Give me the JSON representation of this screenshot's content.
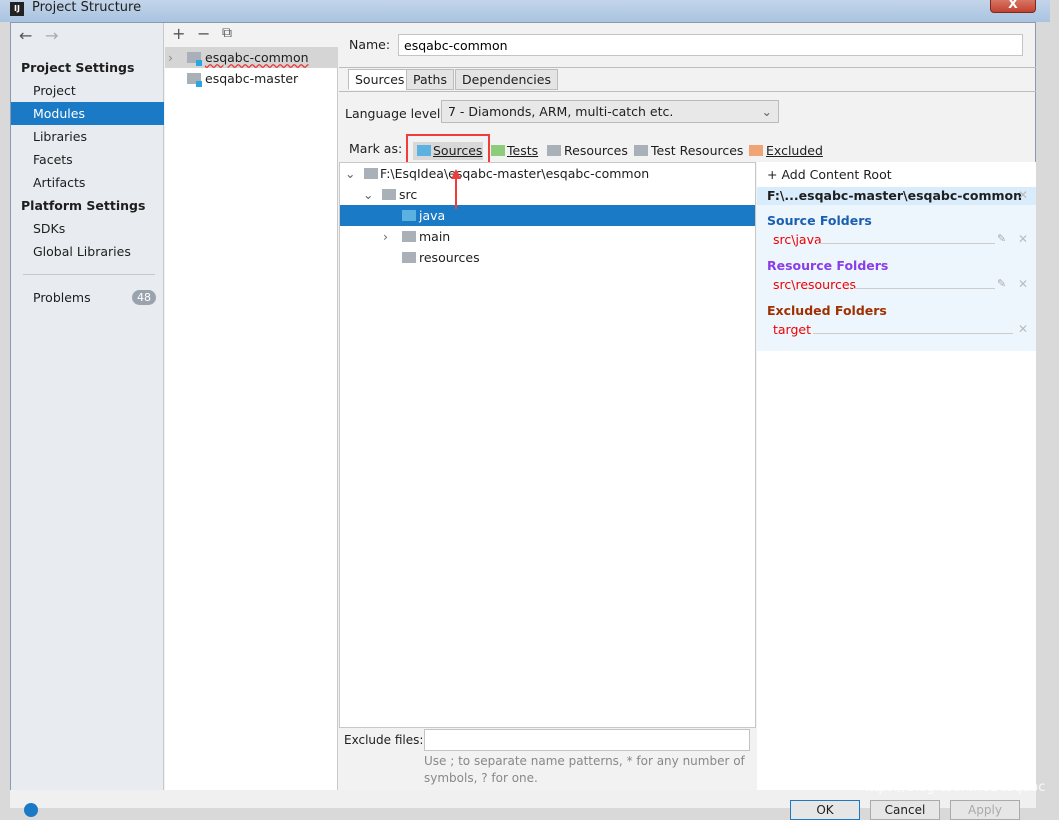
{
  "window": {
    "title": "Project Structure",
    "app_icon": "IJ",
    "close": "X"
  },
  "sidebar": {
    "back": "←",
    "forward": "→",
    "project_settings": "Project Settings",
    "items": [
      {
        "label": "Project"
      },
      {
        "label": "Modules"
      },
      {
        "label": "Libraries"
      },
      {
        "label": "Facets"
      },
      {
        "label": "Artifacts"
      }
    ],
    "platform_settings": "Platform Settings",
    "platform_items": [
      {
        "label": "SDKs"
      },
      {
        "label": "Global Libraries"
      }
    ],
    "problems": {
      "label": "Problems",
      "count": "48"
    }
  },
  "modules": {
    "toolbar": {
      "add": "+",
      "remove": "−",
      "copy": "⧉"
    },
    "items": [
      {
        "label": "esqabc-common",
        "selected": true
      },
      {
        "label": "esqabc-master"
      }
    ]
  },
  "main": {
    "name_label": "Name:",
    "name_value": "esqabc-common",
    "tabs": [
      {
        "label": "Sources"
      },
      {
        "label": "Paths"
      },
      {
        "label": "Dependencies"
      }
    ],
    "language_level_label": "Language level:",
    "language_level_value": "7 - Diamonds, ARM, multi-catch etc.",
    "mark_as_label": "Mark as:",
    "mark_as": [
      {
        "label": "Sources",
        "color": "#5bb2e0"
      },
      {
        "label": "Tests",
        "color": "#8ccc7b"
      },
      {
        "label": "Resources",
        "color": "#a9b0b8"
      },
      {
        "label": "Test Resources",
        "color": "#a9b0b8"
      },
      {
        "label": "Excluded",
        "color": "#f0a476"
      }
    ],
    "tree": [
      {
        "label": "F:\\EsqIdea\\esqabc-master\\esqabc-common"
      },
      {
        "label": "src"
      },
      {
        "label": "java",
        "selected": true
      },
      {
        "label": "main"
      },
      {
        "label": "resources"
      }
    ],
    "exclude_files_label": "Exclude files:",
    "exclude_files_value": "",
    "exclude_hint_1": "Use ; to separate name patterns, * for any number of",
    "exclude_hint_2": "symbols, ? for one."
  },
  "content_root": {
    "add_label": "+ Add Content Root",
    "root_path": "F:\\...esqabc-master\\esqabc-common",
    "source_folders_title": "Source Folders",
    "source_folders": [
      "src\\java"
    ],
    "resource_folders_title": "Resource Folders",
    "resource_folders": [
      "src\\resources"
    ],
    "excluded_folders_title": "Excluded Folders",
    "excluded_folders": [
      "target"
    ],
    "colors": {
      "source": "#1a5fb4",
      "resource": "#8a3ee8",
      "excluded": "#a03000"
    }
  },
  "buttons": {
    "ok": "OK",
    "cancel": "Cancel",
    "apply": "Apply"
  },
  "watermark": "https://blog.csdn.net/esqabc"
}
